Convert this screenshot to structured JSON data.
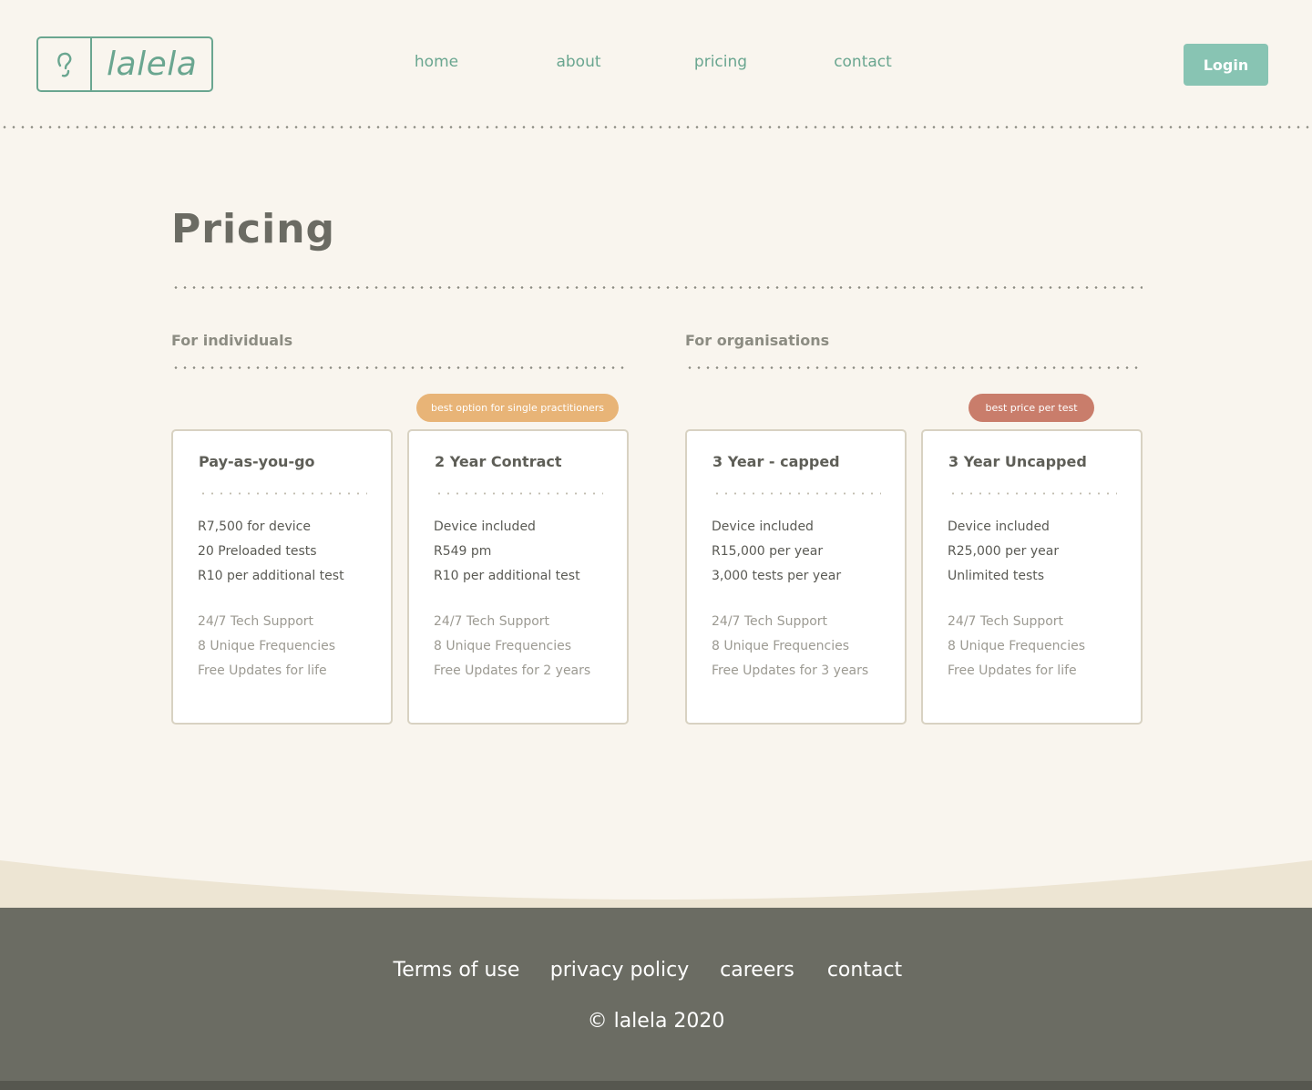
{
  "brand": {
    "name": "lalela",
    "mark_icon": "ear-icon",
    "accent_color": "#6aa690"
  },
  "nav": {
    "home": "home",
    "about": "about",
    "pricing": "pricing",
    "contact": "contact",
    "login": "Login"
  },
  "page": {
    "title": "Pricing"
  },
  "sections": {
    "individuals": "For individuals",
    "organisations": "For organisations"
  },
  "plans": [
    {
      "title": "Pay-as-you-go",
      "badge": "",
      "features": [
        "R7,500 for device",
        "20 Preloaded tests",
        "R10 per additional test"
      ],
      "extras": [
        "24/7 Tech Support",
        "8 Unique Frequencies",
        "Free Updates for life"
      ]
    },
    {
      "title": "2 Year Contract",
      "badge": "best option for single practitioners",
      "badge_color": "#e8b477",
      "features": [
        "Device included",
        "R549 pm",
        "R10 per additional test"
      ],
      "extras": [
        "24/7 Tech Support",
        "8 Unique Frequencies",
        "Free Updates for 2 years"
      ]
    },
    {
      "title": "3 Year - capped",
      "badge": "",
      "features": [
        "Device included",
        "R15,000 per year",
        "3,000 tests per year"
      ],
      "extras": [
        "24/7 Tech Support",
        "8 Unique Frequencies",
        "Free Updates for 3 years"
      ]
    },
    {
      "title": "3 Year Uncapped",
      "badge": "best price per test",
      "badge_color": "#c97d6b",
      "features": [
        "Device included",
        "R25,000 per year",
        "Unlimited tests"
      ],
      "extras": [
        "24/7 Tech Support",
        "8 Unique Frequencies",
        "Free Updates for life"
      ]
    }
  ],
  "footer": {
    "terms": "Terms of use",
    "privacy": "privacy policy",
    "careers": "careers",
    "contact": "contact",
    "copyright": "© lalela 2020"
  }
}
